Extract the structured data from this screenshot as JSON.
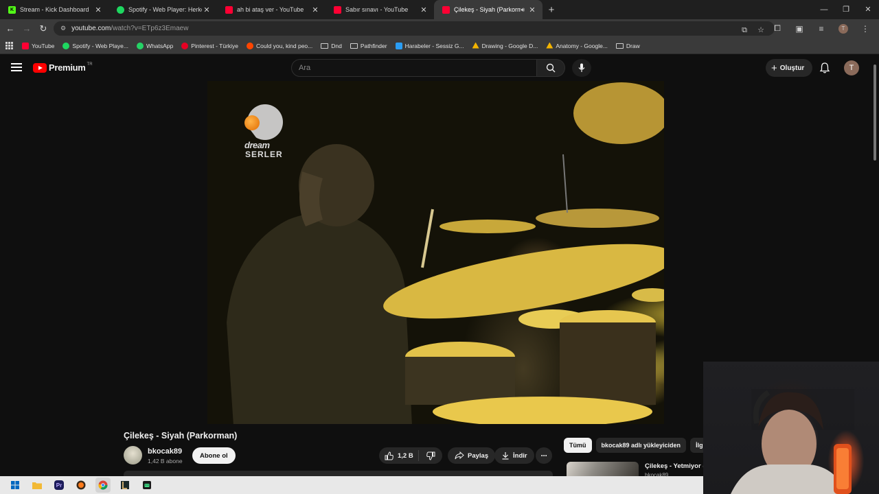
{
  "browser": {
    "tabs": [
      {
        "title": "Stream - Kick Dashboard",
        "icon": "kick-icon",
        "color": "#53fc18"
      },
      {
        "title": "Spotify - Web Player: Herkes için müzik",
        "icon": "spotify-icon",
        "color": "#1ed760"
      },
      {
        "title": "ah bi ataş ver - YouTube",
        "icon": "youtube-icon",
        "color": "#ff0033"
      },
      {
        "title": "Sabır sınavı - YouTube",
        "icon": "youtube-icon",
        "color": "#ff0033"
      },
      {
        "title": "Çilekeş - Siyah (Parkorman) - YouTube",
        "icon": "youtube-icon",
        "color": "#ff0033",
        "active": true,
        "audio": true
      }
    ],
    "new_tab_label": "+",
    "window_controls": {
      "minimize": "—",
      "restore": "❐",
      "close": "✕"
    },
    "url": {
      "host": "youtube.com",
      "path": "/watch?v=ETp6z3Emaew"
    },
    "profile_initial": "T",
    "bookmarks": [
      {
        "label": "YouTube",
        "icon": "youtube-icon",
        "color": "#ff0033"
      },
      {
        "label": "Spotify - Web Playe...",
        "icon": "spotify-icon",
        "color": "#1ed760"
      },
      {
        "label": "WhatsApp",
        "icon": "whatsapp-icon",
        "color": "#25d366"
      },
      {
        "label": "Pinterest - Türkiye",
        "icon": "pinterest-icon",
        "color": "#e60023"
      },
      {
        "label": "Could you, kind peo...",
        "icon": "reddit-icon",
        "color": "#ff4500"
      },
      {
        "label": "Dnd",
        "icon": "folder-icon"
      },
      {
        "label": "Pathfinder",
        "icon": "folder-icon"
      },
      {
        "label": "Harabeler - Sessiz G...",
        "icon": "site-icon",
        "color": "#2a9df4"
      },
      {
        "label": "Drawing - Google D...",
        "icon": "google-drive-icon",
        "color": "#f4b400"
      },
      {
        "label": "Anatomy - Google...",
        "icon": "google-drive-icon",
        "color": "#f4b400"
      },
      {
        "label": "Draw",
        "icon": "folder-icon"
      }
    ]
  },
  "youtube": {
    "logo_word": "Premium",
    "logo_region": "TR",
    "search_placeholder": "Ara",
    "create_label": "Oluştur",
    "avatar_initial": "T",
    "video": {
      "overlay_logo_word": "dream",
      "overlay_logo_sub": "SERLER"
    },
    "title": "Çilekeş - Siyah (Parkorman)",
    "channel": {
      "name": "bkocak89",
      "subscribers": "1,42 B abone"
    },
    "subscribe_label": "Abone ol",
    "likes": "1,2 B",
    "share_label": "Paylaş",
    "download_label": "İndir",
    "chips": [
      "Tümü",
      "bkocak89 adlı yükleyiciden",
      "İlgili"
    ],
    "recommended": {
      "title": "Çilekeş - Yetmiyor (Official",
      "channel": "bkocak89"
    }
  },
  "colors": {
    "accent": "#ff0000",
    "background": "#0f0f0f"
  }
}
